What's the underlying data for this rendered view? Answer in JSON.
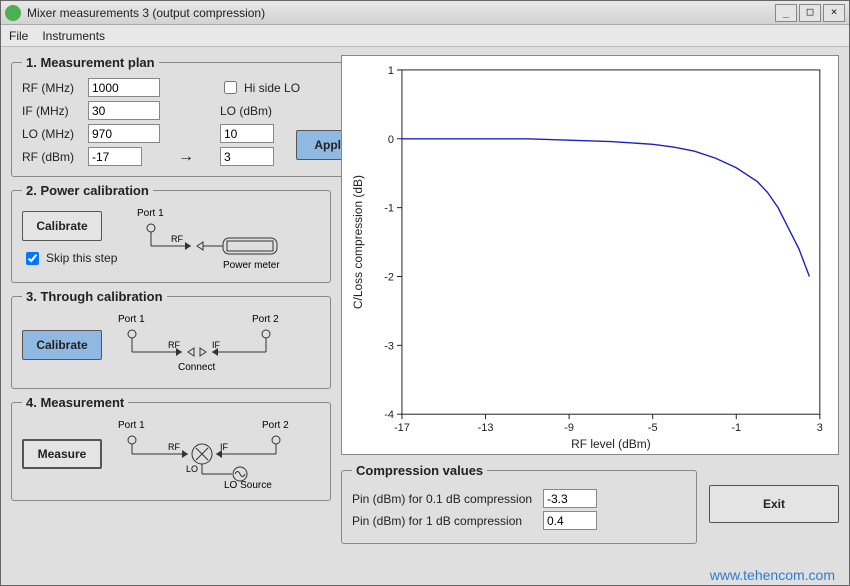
{
  "window": {
    "title": "Mixer measurements 3 (output compression)",
    "min": "_",
    "max": "□",
    "close": "×"
  },
  "menu": {
    "file": "File",
    "instruments": "Instruments"
  },
  "plan": {
    "legend": "1. Measurement plan",
    "rf_mhz_label": "RF (MHz)",
    "rf_mhz": "1000",
    "hi_side_lo_label": "Hi side LO",
    "if_mhz_label": "IF (MHz)",
    "if_mhz": "30",
    "lo_dbm_label": "LO (dBm)",
    "lo_mhz_label": "LO (MHz)",
    "lo_mhz": "970",
    "lo_dbm": "10",
    "rf_dbm_label": "RF (dBm)",
    "rf_dbm_from": "-17",
    "rf_dbm_to": "3",
    "apply": "Apply"
  },
  "powercal": {
    "legend": "2. Power calibration",
    "calibrate": "Calibrate",
    "skip_label": "Skip this step",
    "port1": "Port 1",
    "rf": "RF",
    "power_meter": "Power meter"
  },
  "throughcal": {
    "legend": "3. Through calibration",
    "calibrate": "Calibrate",
    "port1": "Port 1",
    "port2": "Port 2",
    "rf": "RF",
    "if": "IF",
    "connect": "Connect"
  },
  "measurement": {
    "legend": "4. Measurement",
    "measure": "Measure",
    "port1": "Port 1",
    "port2": "Port 2",
    "rf": "RF",
    "if": "IF",
    "lo": "LO",
    "lo_source": "LO Source"
  },
  "compression": {
    "legend": "Compression values",
    "pin01_label": "Pin (dBm) for 0.1 dB compression",
    "pin01": "-3.3",
    "pin1_label": "Pin (dBm) for 1 dB compression",
    "pin1": "0.4"
  },
  "exit": "Exit",
  "watermark": "www.tehencom.com",
  "chart_data": {
    "type": "line",
    "title": "",
    "xlabel": "RF level (dBm)",
    "ylabel": "C/Loss compression (dB)",
    "xlim": [
      -17,
      3
    ],
    "ylim": [
      -4,
      1
    ],
    "xticks": [
      -17,
      -13,
      -9,
      -5,
      -1,
      3
    ],
    "yticks": [
      -4,
      -3,
      -2,
      -1,
      0,
      1
    ],
    "series": [
      {
        "name": "compression",
        "color": "#2020c0",
        "x": [
          -17,
          -15,
          -13,
          -11,
          -9,
          -7,
          -5,
          -4,
          -3,
          -2,
          -1,
          0,
          0.5,
          1,
          1.5,
          2,
          2.5
        ],
        "y": [
          0.0,
          0.0,
          0.0,
          0.0,
          -0.02,
          -0.04,
          -0.08,
          -0.12,
          -0.18,
          -0.28,
          -0.42,
          -0.62,
          -0.78,
          -1.0,
          -1.3,
          -1.6,
          -2.0
        ]
      }
    ]
  }
}
